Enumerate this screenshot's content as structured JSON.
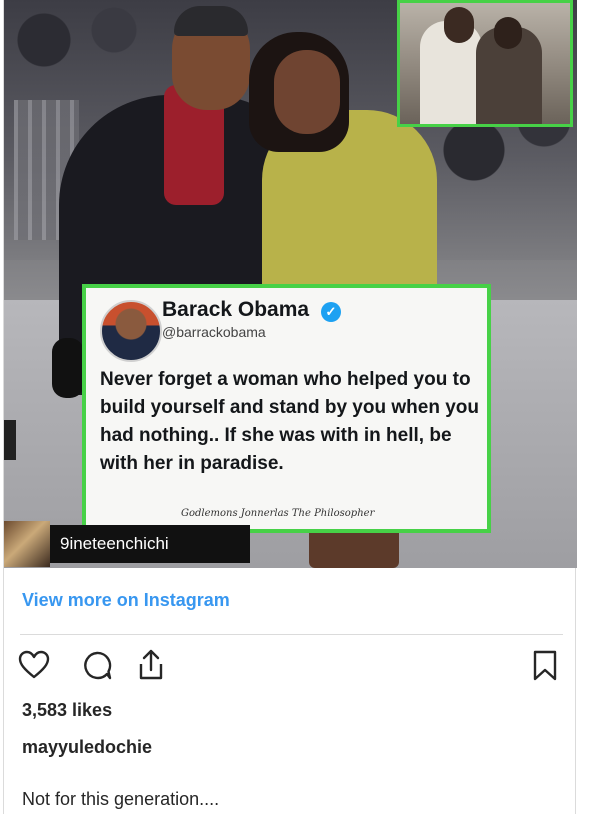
{
  "tweet": {
    "name": "Barack Obama",
    "handle": "@barrackobama",
    "text": "Never forget a woman who helped you to build yourself and stand by you when you had nothing.. If she was with in hell, be with her in paradise.",
    "signature": "Godlemons Jonnerlas The Philosopher"
  },
  "image_tag": {
    "username": "9ineteenchichi"
  },
  "post": {
    "view_more": "View more on Instagram",
    "likes": "3,583 likes",
    "username": "mayyuledochie",
    "caption": "Not for this generation...."
  },
  "icons": {
    "like": "heart-icon",
    "comment": "comment-icon",
    "share": "share-icon",
    "save": "bookmark-icon",
    "verified": "verified-badge-icon"
  },
  "colors": {
    "link": "#3897f0",
    "frame_green": "#47d147",
    "verified": "#1da1f2"
  }
}
